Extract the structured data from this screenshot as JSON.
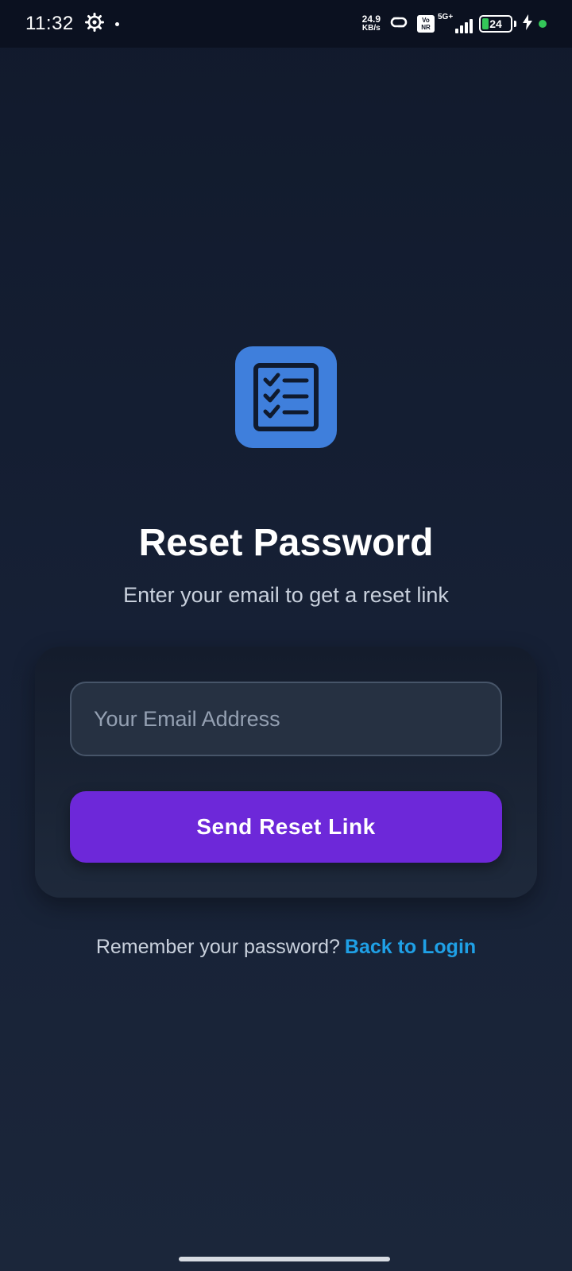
{
  "status_bar": {
    "time": "11:32",
    "net_speed_value": "24.9",
    "net_speed_unit": "KB/s",
    "volte_top": "Vo",
    "volte_bottom": "NR",
    "network": "5G+",
    "battery": "24",
    "icons": [
      "gear-icon",
      "hotspot-icon",
      "volte-icon",
      "signal-icon",
      "battery-icon",
      "charging-icon"
    ]
  },
  "app": {
    "logo_icon": "checklist-icon",
    "title": "Reset Password",
    "subtitle": "Enter your email to get a reset link",
    "email_placeholder": "Your Email Address",
    "email_value": "",
    "send_button_label": "Send Reset Link",
    "footer_text": "Remember your password?",
    "footer_link": "Back to Login"
  },
  "colors": {
    "logo_bg": "#3f7fdc",
    "button_bg": "#6d28d9",
    "link": "#1fa0e6"
  }
}
